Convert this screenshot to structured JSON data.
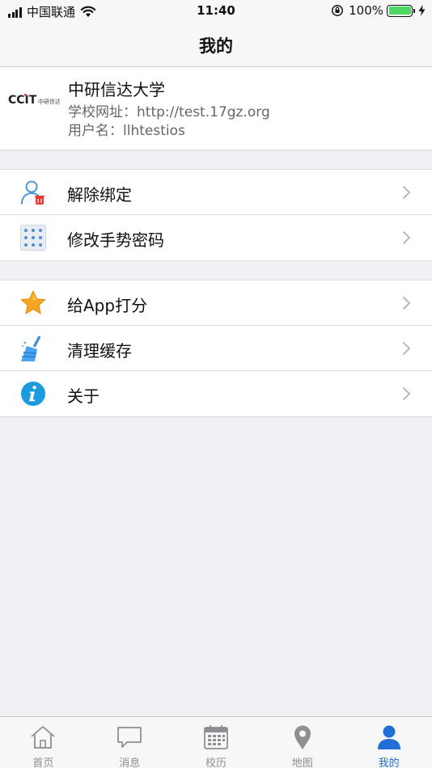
{
  "status_bar": {
    "carrier": "中国联通",
    "time": "11:40",
    "battery_percent": "100%",
    "battery_level": 1.0
  },
  "nav": {
    "title": "我的"
  },
  "profile": {
    "logo_text": "CCIT",
    "logo_sub": "中研信达",
    "school_name": "中研信达大学",
    "url_label": "学校网址：",
    "url_value": "http://test.17gz.org",
    "username_label": "用户名：",
    "username_value": "llhtestios"
  },
  "menu_groups": [
    {
      "items": [
        {
          "label": "解除绑定",
          "icon": "unbind-user-icon"
        },
        {
          "label": "修改手势密码",
          "icon": "gesture-password-icon"
        }
      ]
    },
    {
      "items": [
        {
          "label": "给App打分",
          "icon": "star-icon"
        },
        {
          "label": "清理缓存",
          "icon": "broom-icon"
        },
        {
          "label": "关于",
          "icon": "info-icon"
        }
      ]
    }
  ],
  "tabs": [
    {
      "label": "首页",
      "icon": "home-icon",
      "active": false
    },
    {
      "label": "消息",
      "icon": "message-icon",
      "active": false
    },
    {
      "label": "校历",
      "icon": "calendar-icon",
      "active": false
    },
    {
      "label": "地图",
      "icon": "map-pin-icon",
      "active": false
    },
    {
      "label": "我的",
      "icon": "profile-icon",
      "active": true
    }
  ],
  "colors": {
    "accent": "#1f6fd6",
    "battery": "#4cd964",
    "delete_red": "#e53935",
    "star": "#f5a623",
    "info": "#1a9be0"
  }
}
